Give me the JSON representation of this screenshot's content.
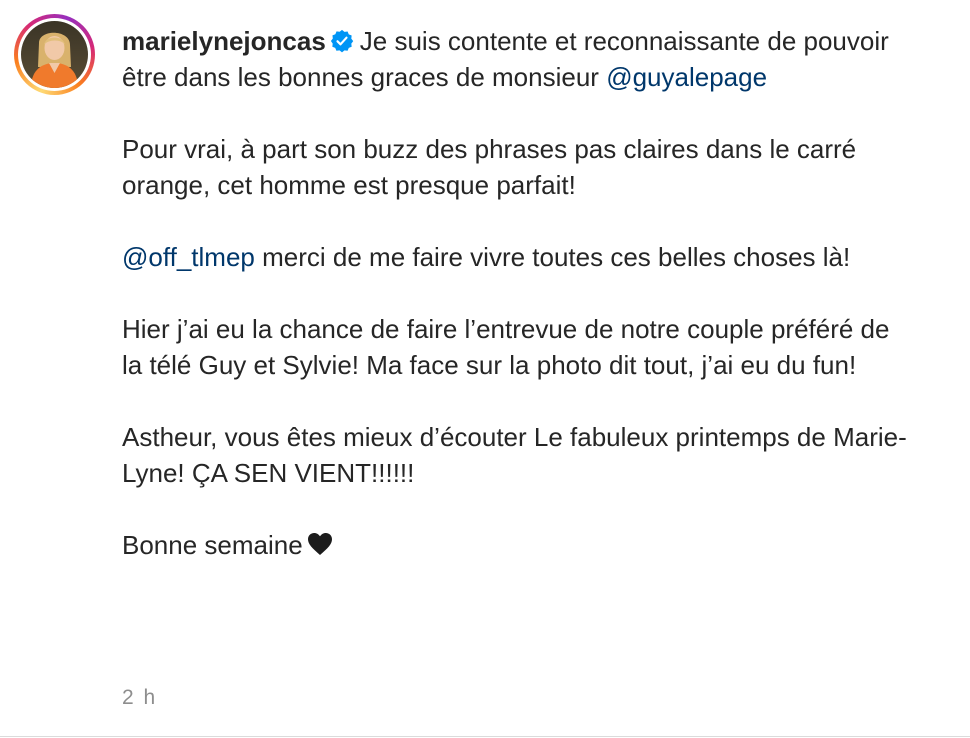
{
  "post": {
    "username": "marielynejoncas",
    "verified_icon": "verified-badge-icon",
    "avatar_icon": "profile-avatar",
    "caption": {
      "p1_text": "Je suis contente et reconnaissante de pouvoir être dans les bonnes graces de monsieur",
      "p1_mention": "@guyalepage",
      "p2_text": "Pour vrai, à part son buzz des phrases pas claires dans le carré orange, cet homme est presque parfait!",
      "p3_mention": "@off_tlmep",
      "p3_text": "merci de me faire vivre toutes ces belles choses là!",
      "p4_text": "Hier j’ai eu la chance de faire l’entrevue de notre couple préféré de la télé Guy et Sylvie! Ma face sur la photo dit tout, j’ai eu du fun!",
      "p5_text": "Astheur, vous êtes mieux d’écouter Le fabuleux printemps de Marie-Lyne! ÇA SEN VIENT!!!!!!",
      "p6_text": "Bonne semaine",
      "p6_emoji_icon": "black-heart-icon"
    },
    "timestamp": "2 h",
    "colors": {
      "text": "#262626",
      "mention": "#00376b",
      "timestamp": "#8e8e8e",
      "verified": "#0095f6"
    }
  }
}
